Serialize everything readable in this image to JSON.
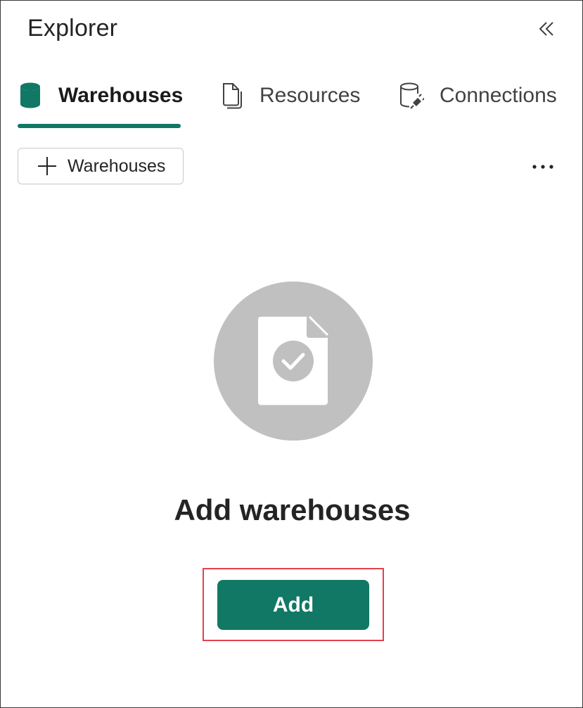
{
  "header": {
    "title": "Explorer",
    "collapse_icon": "double-chevron-left-icon"
  },
  "tabs": [
    {
      "label": "Warehouses",
      "icon": "database-icon",
      "active": true
    },
    {
      "label": "Resources",
      "icon": "documents-icon",
      "active": false
    },
    {
      "label": "Connections",
      "icon": "database-plug-icon",
      "active": false
    }
  ],
  "toolbar": {
    "add_label": "Warehouses",
    "add_icon": "plus-icon",
    "more_icon": "more-horizontal-icon"
  },
  "empty_state": {
    "illustration_icon": "document-check-icon",
    "title": "Add warehouses",
    "button_label": "Add"
  },
  "colors": {
    "accent": "#117865",
    "highlight_border": "#e0424e",
    "illustration_bg": "#c0c0c0"
  }
}
